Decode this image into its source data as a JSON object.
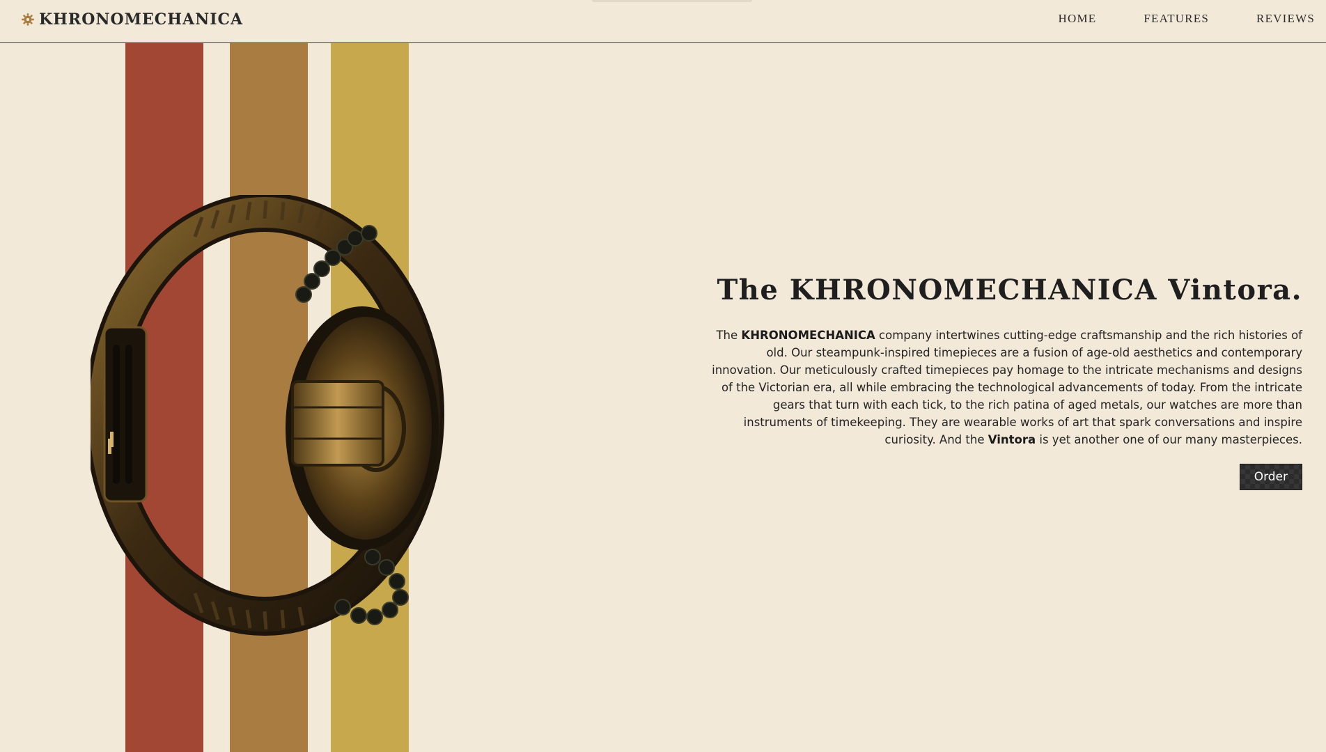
{
  "header": {
    "brand": "KHRONOMECHANICA",
    "brand_icon": "gear-icon",
    "nav": [
      "HOME",
      "FEATURES",
      "REVIEWS"
    ]
  },
  "stripes": {
    "colors": [
      "#a34735",
      "#a97d41",
      "#c7a84d"
    ]
  },
  "hero": {
    "title": "The KHRONOMECHANICA Vintora.",
    "text_intro": "The",
    "brand_bold": "KHRONOMECHANICA",
    "text_body": "company intertwines cutting-edge craftsmanship and the rich histories of old. Our steampunk-inspired timepieces are a fusion of age-old aesthetics and contemporary innovation. Our meticulously crafted timepieces pay homage to the intricate mechanisms and designs of the Victorian era, all while embracing the technological advancements of today. From the intricate gears that turn with each tick, to the rich patina of aged metals, our watches are more than instruments of timekeeping. They are wearable works of art that spark conversations and inspire curiosity. And the",
    "product_bold": "Vintora",
    "text_outro": "is yet another one of our many masterpieces.",
    "order_label": "Order"
  },
  "colors": {
    "background": "#f2e9d9",
    "text": "#1d1d1d",
    "button": "#2b2b2b"
  }
}
